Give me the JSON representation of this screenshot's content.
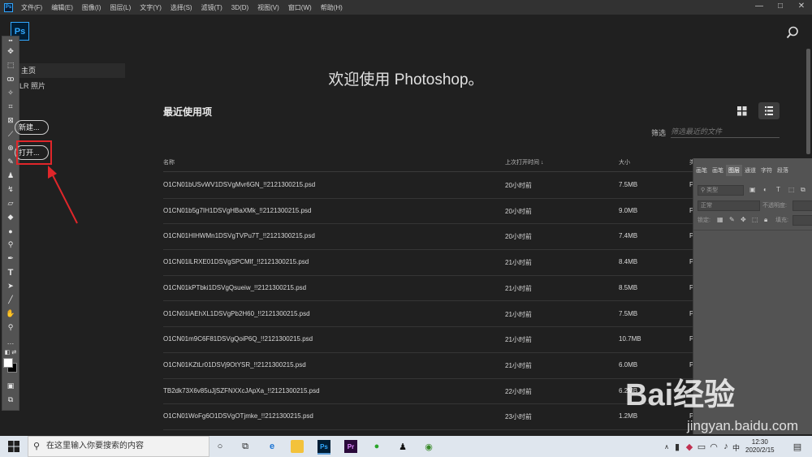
{
  "menubar": {
    "items": [
      "文件(F)",
      "编辑(E)",
      "图像(I)",
      "图层(L)",
      "文字(Y)",
      "选择(S)",
      "滤镜(T)",
      "3D(D)",
      "视图(V)",
      "窗口(W)",
      "帮助(H)"
    ],
    "logo": "Ps",
    "window_controls": [
      "—",
      "□",
      "✕"
    ]
  },
  "header": {
    "logo": "Ps"
  },
  "home": {
    "nav_home": "主页",
    "nav_lr": "LR 照片",
    "new_label": "新建...",
    "open_label": "打开..."
  },
  "main": {
    "welcome": "欢迎使用 Photoshop。",
    "recent_title": "最近使用项",
    "filter_label": "筛选",
    "filter_placeholder": "筛选最近的文件",
    "columns": {
      "name": "名称",
      "opened": "上次打开时间",
      "size": "大小",
      "kind": "类"
    }
  },
  "files": [
    {
      "name": "O1CN01bUSvWV1DSVgMvr6GN_!!2121300215.psd",
      "opened": "20小时前",
      "size": "7.5MB",
      "kind": "P"
    },
    {
      "name": "O1CN01b5g7IH1DSVgHBaXMk_!!2121300215.psd",
      "opened": "20小时前",
      "size": "9.0MB",
      "kind": "P"
    },
    {
      "name": "O1CN01HIHWMn1DSVgTVPu7T_!!2121300215.psd",
      "opened": "20小时前",
      "size": "7.4MB",
      "kind": "P"
    },
    {
      "name": "O1CN01lLRXE01DSVgSPCMlf_!!2121300215.psd",
      "opened": "21小时前",
      "size": "8.4MB",
      "kind": "P"
    },
    {
      "name": "O1CN01kPTbki1DSVgQsueiw_!!2121300215.psd",
      "opened": "21小时前",
      "size": "8.5MB",
      "kind": "P"
    },
    {
      "name": "O1CN01lAEhXL1DSVgPb2H60_!!2121300215.psd",
      "opened": "21小时前",
      "size": "7.5MB",
      "kind": "P"
    },
    {
      "name": "O1CN01m9C6F81DSVgQoiP6Q_!!2121300215.psd",
      "opened": "21小时前",
      "size": "10.7MB",
      "kind": "P"
    },
    {
      "name": "O1CN01KZtLr01DSVj9OtYSR_!!2121300215.psd",
      "opened": "21小时前",
      "size": "6.0MB",
      "kind": "P"
    },
    {
      "name": "TB2dk73X6v85uJjSZFNXXcJApXa_!!2121300215.psd",
      "opened": "22小时前",
      "size": "6.2MB",
      "kind": "P"
    },
    {
      "name": "O1CN01WoFg6O1DSVgOTjmke_!!2121300215.psd",
      "opened": "23小时前",
      "size": "1.2MB",
      "kind": "P"
    }
  ],
  "layers_panel": {
    "tabs": [
      "画笔",
      "画笔",
      "图层",
      "通道",
      "字符",
      "段落"
    ],
    "kind_placeholder": "类型",
    "blend_mode": "正常",
    "opacity_label": "不透明度:",
    "lock_label": "锁定:",
    "fill_label": "填充:"
  },
  "watermark": {
    "logo": "Bai经验",
    "url": "jingyan.baidu.com"
  },
  "taskbar": {
    "search_placeholder": "在这里输入你要搜索的内容",
    "lang": "中",
    "time": "12:30",
    "date": "2020/2/15"
  },
  "colors": {
    "accent": "#31a8ff",
    "highlight": "#e0262a",
    "bg": "#202020"
  }
}
